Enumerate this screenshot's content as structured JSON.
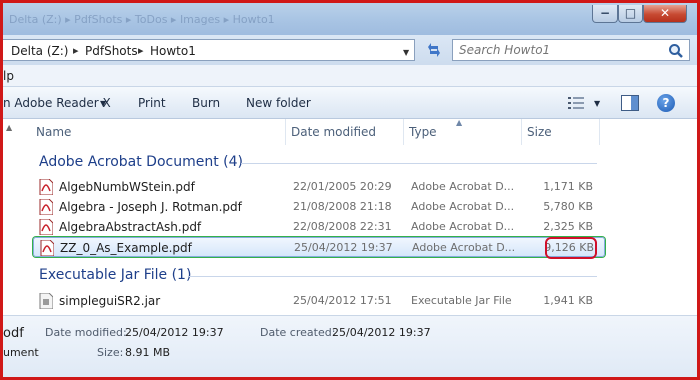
{
  "window": {
    "title_crumbs": "Delta (Z:) ▸ PdfShots ▸ ToDos ▸ Images ▸ Howto1",
    "min_glyph": "−",
    "max_glyph": "□",
    "close_glyph": "✕"
  },
  "address": {
    "segments": [
      "Delta (Z:)",
      "PdfShots",
      "Howto1"
    ],
    "separator": "▸"
  },
  "search": {
    "placeholder": "Search Howto1"
  },
  "menubar": {
    "help_partial": "lp"
  },
  "toolbar": {
    "open_with": "n Adobe Reader X",
    "print": "Print",
    "burn": "Burn",
    "new_folder": "New folder"
  },
  "columns": {
    "name": "Name",
    "date": "Date modified",
    "type": "Type",
    "size": "Size"
  },
  "groups": [
    {
      "header": "Adobe Acrobat Document (4)",
      "files": [
        {
          "name": "AlgebNumbWStein.pdf",
          "date": "22/01/2005 20:29",
          "type": "Adobe Acrobat D...",
          "size": "1,171 KB"
        },
        {
          "name": "Algebra - Joseph J. Rotman.pdf",
          "date": "21/08/2008 21:18",
          "type": "Adobe Acrobat D...",
          "size": "5,780 KB"
        },
        {
          "name": "AlgebraAbstractAsh.pdf",
          "date": "22/08/2008 22:31",
          "type": "Adobe Acrobat D...",
          "size": "2,325 KB"
        },
        {
          "name": "ZZ_0_As_Example.pdf",
          "date": "25/04/2012 19:37",
          "type": "Adobe Acrobat D...",
          "size": "9,126 KB"
        }
      ]
    },
    {
      "header": "Executable Jar File (1)",
      "files": [
        {
          "name": "simpleguiSR2.jar",
          "date": "25/04/2012 17:51",
          "type": "Executable Jar File",
          "size": "1,941 KB"
        }
      ]
    }
  ],
  "details": {
    "name_partial": "odf",
    "type_partial": "ument",
    "modified_label": "Date modified:",
    "modified_value": "25/04/2012 19:37",
    "created_label": "Date created:",
    "created_value": "25/04/2012 19:37",
    "size_label": "Size:",
    "size_value": "8.91 MB"
  },
  "colors": {
    "accent": "#1e3f8a",
    "selection": "#d6e7fb",
    "highlight_red": "#d0102a",
    "selection_green": "#35b04a"
  }
}
